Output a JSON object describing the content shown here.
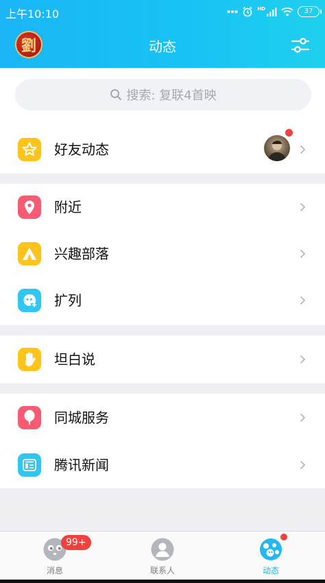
{
  "status_bar": {
    "time": "上午10:10",
    "network": "HD",
    "battery": "37"
  },
  "header": {
    "avatar_char": "劉",
    "title": "动态",
    "filter_icon": "sliders-icon"
  },
  "search": {
    "placeholder": "搜索: 复联4首映"
  },
  "groups": [
    {
      "items": [
        {
          "label": "好友动态",
          "icon": "star-icon",
          "color": "#ffc41a"
        }
      ]
    },
    {
      "items": [
        {
          "label": "附近",
          "icon": "location-pin-icon",
          "color": "#f95b73"
        },
        {
          "label": "兴趣部落",
          "icon": "tent-icon",
          "color": "#ffc41a"
        },
        {
          "label": "扩列",
          "icon": "ghost-icon",
          "color": "#2fc6f2"
        }
      ]
    },
    {
      "items": [
        {
          "label": "坦白说",
          "icon": "hand-icon",
          "color": "#ffc41a"
        }
      ]
    },
    {
      "items": [
        {
          "label": "同城服务",
          "icon": "balloon-icon",
          "color": "#f95b73"
        },
        {
          "label": "腾讯新闻",
          "icon": "news-icon",
          "color": "#2fc6f2"
        }
      ]
    }
  ],
  "tabbar": {
    "tabs": [
      {
        "label": "消息",
        "icon": "message-face-icon"
      },
      {
        "label": "联系人",
        "icon": "contacts-icon"
      },
      {
        "label": "动态",
        "icon": "planet-icon",
        "active": true
      }
    ],
    "message_badge": "99+"
  },
  "colors": {
    "accent": "#12b7f5",
    "badge": "#f2403c"
  }
}
